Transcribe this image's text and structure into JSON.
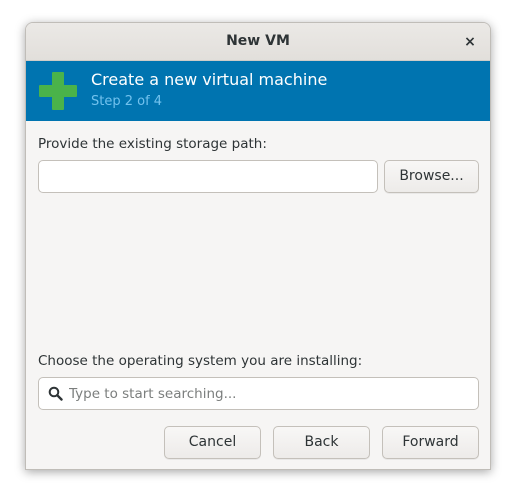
{
  "window": {
    "title": "New VM",
    "close_symbol": "×"
  },
  "banner": {
    "title": "Create a new virtual machine",
    "step": "Step 2 of 4",
    "icon": "plus-icon",
    "background_color": "#0074b0",
    "icon_color": "#4ab34a"
  },
  "storage": {
    "label": "Provide the existing storage path:",
    "value": "",
    "browse_label": "Browse..."
  },
  "os": {
    "label": "Choose the operating system you are installing:",
    "search_placeholder": "Type to start searching...",
    "search_icon": "search-icon"
  },
  "buttons": {
    "cancel": "Cancel",
    "back": "Back",
    "forward": "Forward"
  }
}
